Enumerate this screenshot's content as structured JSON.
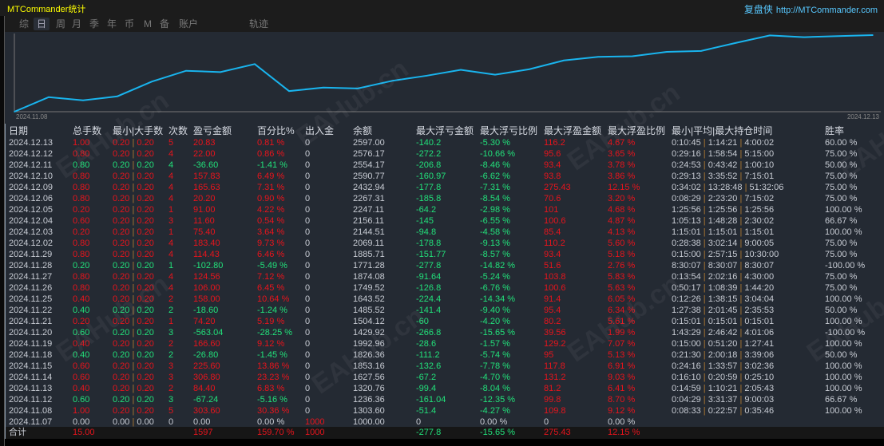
{
  "app": {
    "title": "MTCommander统计",
    "brand_cn": "复盘侠",
    "brand_url": "http://MTCommander.com"
  },
  "tabs": [
    {
      "label": "综"
    },
    {
      "label": "日",
      "active": true
    },
    {
      "label": "周"
    },
    {
      "label": "月"
    },
    {
      "label": "季"
    },
    {
      "label": "年"
    },
    {
      "label": "币"
    },
    {
      "label": "M"
    },
    {
      "label": "备"
    },
    {
      "label": "账户"
    },
    {
      "label": "轨迹"
    }
  ],
  "chart_data": {
    "type": "line",
    "x_start_label": "2024.11.08",
    "x_end_label": "2024.12.13",
    "line_color": "#19b4ee"
  },
  "columns": [
    "日期",
    "总手数",
    "最小|大手数",
    "次数",
    "盈亏金额",
    "百分比%",
    "出入金",
    "余额",
    "最大浮亏金额",
    "最大浮亏比例",
    "最大浮盈金额",
    "最大浮盈比例",
    "最小|平均|最大持仓时间",
    "胜率"
  ],
  "rows": [
    {
      "s": "r",
      "v": [
        "2024.12.13",
        "1.00",
        "0.20",
        "0.20",
        "5",
        "20.83",
        "0.81 %",
        "0",
        "2597.00",
        "-140.2",
        "-5.30 %",
        "116.2",
        "4.67 %",
        "0:10:45",
        "1:14:21",
        "4:00:02",
        "60.00 %"
      ]
    },
    {
      "s": "r",
      "v": [
        "2024.12.12",
        "0.80",
        "0.20",
        "0.20",
        "4",
        "22.00",
        "0.86 %",
        "0",
        "2576.17",
        "-272.2",
        "-10.66 %",
        "95.6",
        "3.65 %",
        "0:29:16",
        "1:58:54",
        "5:15:00",
        "75.00 %"
      ]
    },
    {
      "s": "g",
      "v": [
        "2024.12.11",
        "0.80",
        "0.20",
        "0.20",
        "4",
        "-36.60",
        "-1.41 %",
        "0",
        "2554.17",
        "-206.8",
        "-8.46 %",
        "93.4",
        "3.78 %",
        "0:24:53",
        "0:43:42",
        "1:00:10",
        "50.00 %"
      ]
    },
    {
      "s": "r",
      "v": [
        "2024.12.10",
        "0.80",
        "0.20",
        "0.20",
        "4",
        "157.83",
        "6.49 %",
        "0",
        "2590.77",
        "-160.97",
        "-6.62 %",
        "93.8",
        "3.86 %",
        "0:29:13",
        "3:35:52",
        "7:15:01",
        "75.00 %"
      ]
    },
    {
      "s": "r",
      "v": [
        "2024.12.09",
        "0.80",
        "0.20",
        "0.20",
        "4",
        "165.63",
        "7.31 %",
        "0",
        "2432.94",
        "-177.8",
        "-7.31 %",
        "275.43",
        "12.15 %",
        "0:34:02",
        "13:28:48",
        "51:32:06",
        "75.00 %"
      ]
    },
    {
      "s": "r",
      "v": [
        "2024.12.06",
        "0.80",
        "0.20",
        "0.20",
        "4",
        "20.20",
        "0.90 %",
        "0",
        "2267.31",
        "-185.8",
        "-8.54 %",
        "70.6",
        "3.20 %",
        "0:08:29",
        "2:23:20",
        "7:15:02",
        "75.00 %"
      ]
    },
    {
      "s": "r",
      "v": [
        "2024.12.05",
        "0.20",
        "0.20",
        "0.20",
        "1",
        "91.00",
        "4.22 %",
        "0",
        "2247.11",
        "-64.2",
        "-2.98 %",
        "101",
        "4.68 %",
        "1:25:56",
        "1:25:56",
        "1:25:56",
        "100.00 %"
      ]
    },
    {
      "s": "r",
      "v": [
        "2024.12.04",
        "0.60",
        "0.20",
        "0.20",
        "3",
        "11.60",
        "0.54 %",
        "0",
        "2156.11",
        "-145",
        "-6.55 %",
        "100.6",
        "4.87 %",
        "1:05:13",
        "1:48:28",
        "2:30:02",
        "66.67 %"
      ]
    },
    {
      "s": "r",
      "v": [
        "2024.12.03",
        "0.20",
        "0.20",
        "0.20",
        "1",
        "75.40",
        "3.64 %",
        "0",
        "2144.51",
        "-94.8",
        "-4.58 %",
        "85.4",
        "4.13 %",
        "1:15:01",
        "1:15:01",
        "1:15:01",
        "100.00 %"
      ]
    },
    {
      "s": "r",
      "v": [
        "2024.12.02",
        "0.80",
        "0.20",
        "0.20",
        "4",
        "183.40",
        "9.73 %",
        "0",
        "2069.11",
        "-178.8",
        "-9.13 %",
        "110.2",
        "5.60 %",
        "0:28:38",
        "3:02:14",
        "9:00:05",
        "75.00 %"
      ]
    },
    {
      "s": "r",
      "v": [
        "2024.11.29",
        "0.80",
        "0.20",
        "0.20",
        "4",
        "114.43",
        "6.46 %",
        "0",
        "1885.71",
        "-151.77",
        "-8.57 %",
        "93.4",
        "5.18 %",
        "0:15:00",
        "2:57:15",
        "10:30:00",
        "75.00 %"
      ]
    },
    {
      "s": "g",
      "v": [
        "2024.11.28",
        "0.20",
        "0.20",
        "0.20",
        "1",
        "-102.80",
        "-5.49 %",
        "0",
        "1771.28",
        "-277.8",
        "-14.82 %",
        "51.6",
        "2.76 %",
        "8:30:07",
        "8:30:07",
        "8:30:07",
        "-100.00 %"
      ]
    },
    {
      "s": "r",
      "v": [
        "2024.11.27",
        "0.80",
        "0.20",
        "0.20",
        "4",
        "124.56",
        "7.12 %",
        "0",
        "1874.08",
        "-91.64",
        "-5.24 %",
        "103.8",
        "5.83 %",
        "0:13:54",
        "2:02:16",
        "4:30:00",
        "75.00 %"
      ]
    },
    {
      "s": "r",
      "v": [
        "2024.11.26",
        "0.80",
        "0.20",
        "0.20",
        "4",
        "106.00",
        "6.45 %",
        "0",
        "1749.52",
        "-126.8",
        "-6.76 %",
        "100.6",
        "5.63 %",
        "0:50:17",
        "1:08:39",
        "1:44:20",
        "75.00 %"
      ]
    },
    {
      "s": "r",
      "v": [
        "2024.11.25",
        "0.40",
        "0.20",
        "0.20",
        "2",
        "158.00",
        "10.64 %",
        "0",
        "1643.52",
        "-224.4",
        "-14.34 %",
        "91.4",
        "6.05 %",
        "0:12:26",
        "1:38:15",
        "3:04:04",
        "100.00 %"
      ]
    },
    {
      "s": "g",
      "v": [
        "2024.11.22",
        "0.40",
        "0.20",
        "0.20",
        "2",
        "-18.60",
        "-1.24 %",
        "0",
        "1485.52",
        "-141.4",
        "-9.40 %",
        "95.4",
        "6.34 %",
        "1:27:38",
        "2:01:45",
        "2:35:53",
        "50.00 %"
      ]
    },
    {
      "s": "r",
      "v": [
        "2024.11.21",
        "0.20",
        "0.20",
        "0.20",
        "1",
        "74.20",
        "5.19 %",
        "0",
        "1504.12",
        "-60",
        "-4.20 %",
        "80.2",
        "5.61 %",
        "0:15:01",
        "0:15:01",
        "0:15:01",
        "100.00 %"
      ]
    },
    {
      "s": "g",
      "v": [
        "2024.11.20",
        "0.60",
        "0.20",
        "0.20",
        "3",
        "-563.04",
        "-28.25 %",
        "0",
        "1429.92",
        "-266.8",
        "-15.65 %",
        "39.56",
        "1.99 %",
        "1:43:29",
        "2:46:42",
        "4:01:06",
        "-100.00 %"
      ]
    },
    {
      "s": "r",
      "v": [
        "2024.11.19",
        "0.40",
        "0.20",
        "0.20",
        "2",
        "166.60",
        "9.12 %",
        "0",
        "1992.96",
        "-28.6",
        "-1.57 %",
        "129.2",
        "7.07 %",
        "0:15:00",
        "0:51:20",
        "1:27:41",
        "100.00 %"
      ]
    },
    {
      "s": "g",
      "v": [
        "2024.11.18",
        "0.40",
        "0.20",
        "0.20",
        "2",
        "-26.80",
        "-1.45 %",
        "0",
        "1826.36",
        "-111.2",
        "-5.74 %",
        "95",
        "5.13 %",
        "0:21:30",
        "2:00:18",
        "3:39:06",
        "50.00 %"
      ]
    },
    {
      "s": "r",
      "v": [
        "2024.11.15",
        "0.60",
        "0.20",
        "0.20",
        "3",
        "225.60",
        "13.86 %",
        "0",
        "1853.16",
        "-132.6",
        "-7.78 %",
        "117.8",
        "6.91 %",
        "0:24:16",
        "1:33:57",
        "3:02:36",
        "100.00 %"
      ]
    },
    {
      "s": "r",
      "v": [
        "2024.11.14",
        "0.60",
        "0.20",
        "0.20",
        "3",
        "306.80",
        "23.23 %",
        "0",
        "1627.56",
        "-67.2",
        "-4.70 %",
        "131.2",
        "9.03 %",
        "0:16:10",
        "0:20:59",
        "0:25:10",
        "100.00 %"
      ]
    },
    {
      "s": "r",
      "v": [
        "2024.11.13",
        "0.40",
        "0.20",
        "0.20",
        "2",
        "84.40",
        "6.83 %",
        "0",
        "1320.76",
        "-99.4",
        "-8.04 %",
        "81.2",
        "6.41 %",
        "0:14:59",
        "1:10:21",
        "2:05:43",
        "100.00 %"
      ]
    },
    {
      "s": "g",
      "v": [
        "2024.11.12",
        "0.60",
        "0.20",
        "0.20",
        "3",
        "-67.24",
        "-5.16 %",
        "0",
        "1236.36",
        "-161.04",
        "-12.35 %",
        "99.8",
        "8.70 %",
        "0:04:29",
        "3:31:37",
        "9:00:03",
        "66.67 %"
      ]
    },
    {
      "s": "r",
      "v": [
        "2024.11.08",
        "1.00",
        "0.20",
        "0.20",
        "5",
        "303.60",
        "30.36 %",
        "0",
        "1303.60",
        "-51.4",
        "-4.27 %",
        "109.8",
        "9.12 %",
        "0:08:33",
        "0:22:57",
        "0:35:46",
        "100.00 %"
      ]
    },
    {
      "s": "n",
      "v": [
        "2024.11.07",
        "0.00",
        "0.00",
        "0.00",
        "0",
        "0.00",
        "0.00 %",
        "1000",
        "1000.00",
        "0",
        "0.00 %",
        "0",
        "0.00 %",
        "",
        "",
        "",
        ""
      ]
    }
  ],
  "total": {
    "label": "合计",
    "lots": "15.00",
    "pnl": "1597",
    "pct": "159.70 %",
    "deposit": "1000",
    "max_float_loss": "-277.8",
    "max_float_loss_pct": "-15.65 %",
    "max_float_profit": "275.43",
    "max_float_profit_pct": "12.15 %"
  },
  "watermark": "EAHub.cn"
}
